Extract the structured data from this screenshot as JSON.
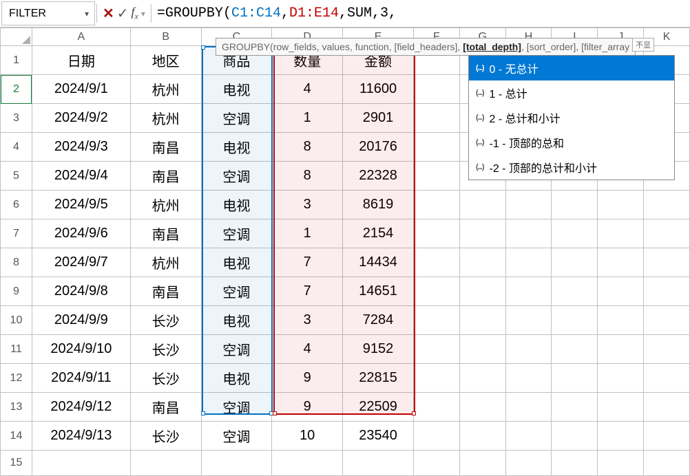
{
  "namebox": {
    "value": "FILTER"
  },
  "formula": {
    "prefix": "=GROUPBY(",
    "ref1": "C1:C14",
    "sep1": ",",
    "ref2": "D1:E14",
    "rest": ",SUM,3,"
  },
  "tooltip": {
    "func": "GROUPBY(",
    "args_before": "row_fields, values, function, [field_headers], ",
    "current": "[total_depth]",
    "args_after": ", [sort_order], [filter_array",
    "badge": "不显"
  },
  "autocomplete": {
    "selected_index": 0,
    "items": [
      {
        "label": "0 - 无总计"
      },
      {
        "label": "1 - 总计"
      },
      {
        "label": "2 - 总计和小计"
      },
      {
        "label": "-1 - 顶部的总和"
      },
      {
        "label": "-2 - 顶部的总计和小计"
      }
    ]
  },
  "columns": [
    "A",
    "B",
    "C",
    "D",
    "E",
    "F",
    "G",
    "H",
    "I",
    "J",
    "K"
  ],
  "headers": {
    "A": "日期",
    "B": "地区",
    "C": "商品",
    "D": "数量",
    "E": "金额"
  },
  "rows": [
    {
      "n": 1,
      "A": "日期",
      "B": "地区",
      "C": "商品",
      "D": "数量",
      "E": "金额"
    },
    {
      "n": 2,
      "A": "2024/9/1",
      "B": "杭州",
      "C": "电视",
      "D": "4",
      "E": "11600"
    },
    {
      "n": 3,
      "A": "2024/9/2",
      "B": "杭州",
      "C": "空调",
      "D": "1",
      "E": "2901"
    },
    {
      "n": 4,
      "A": "2024/9/3",
      "B": "南昌",
      "C": "电视",
      "D": "8",
      "E": "20176"
    },
    {
      "n": 5,
      "A": "2024/9/4",
      "B": "南昌",
      "C": "空调",
      "D": "8",
      "E": "22328"
    },
    {
      "n": 6,
      "A": "2024/9/5",
      "B": "杭州",
      "C": "电视",
      "D": "3",
      "E": "8619"
    },
    {
      "n": 7,
      "A": "2024/9/6",
      "B": "南昌",
      "C": "空调",
      "D": "1",
      "E": "2154"
    },
    {
      "n": 8,
      "A": "2024/9/7",
      "B": "杭州",
      "C": "电视",
      "D": "7",
      "E": "14434"
    },
    {
      "n": 9,
      "A": "2024/9/8",
      "B": "南昌",
      "C": "空调",
      "D": "7",
      "E": "14651"
    },
    {
      "n": 10,
      "A": "2024/9/9",
      "B": "长沙",
      "C": "电视",
      "D": "3",
      "E": "7284"
    },
    {
      "n": 11,
      "A": "2024/9/10",
      "B": "长沙",
      "C": "空调",
      "D": "4",
      "E": "9152"
    },
    {
      "n": 12,
      "A": "2024/9/11",
      "B": "长沙",
      "C": "电视",
      "D": "9",
      "E": "22815"
    },
    {
      "n": 13,
      "A": "2024/9/12",
      "B": "南昌",
      "C": "空调",
      "D": "9",
      "E": "22509"
    },
    {
      "n": 14,
      "A": "2024/9/13",
      "B": "长沙",
      "C": "空调",
      "D": "10",
      "E": "23540"
    },
    {
      "n": 15,
      "A": "",
      "B": "",
      "C": "",
      "D": "",
      "E": ""
    }
  ]
}
